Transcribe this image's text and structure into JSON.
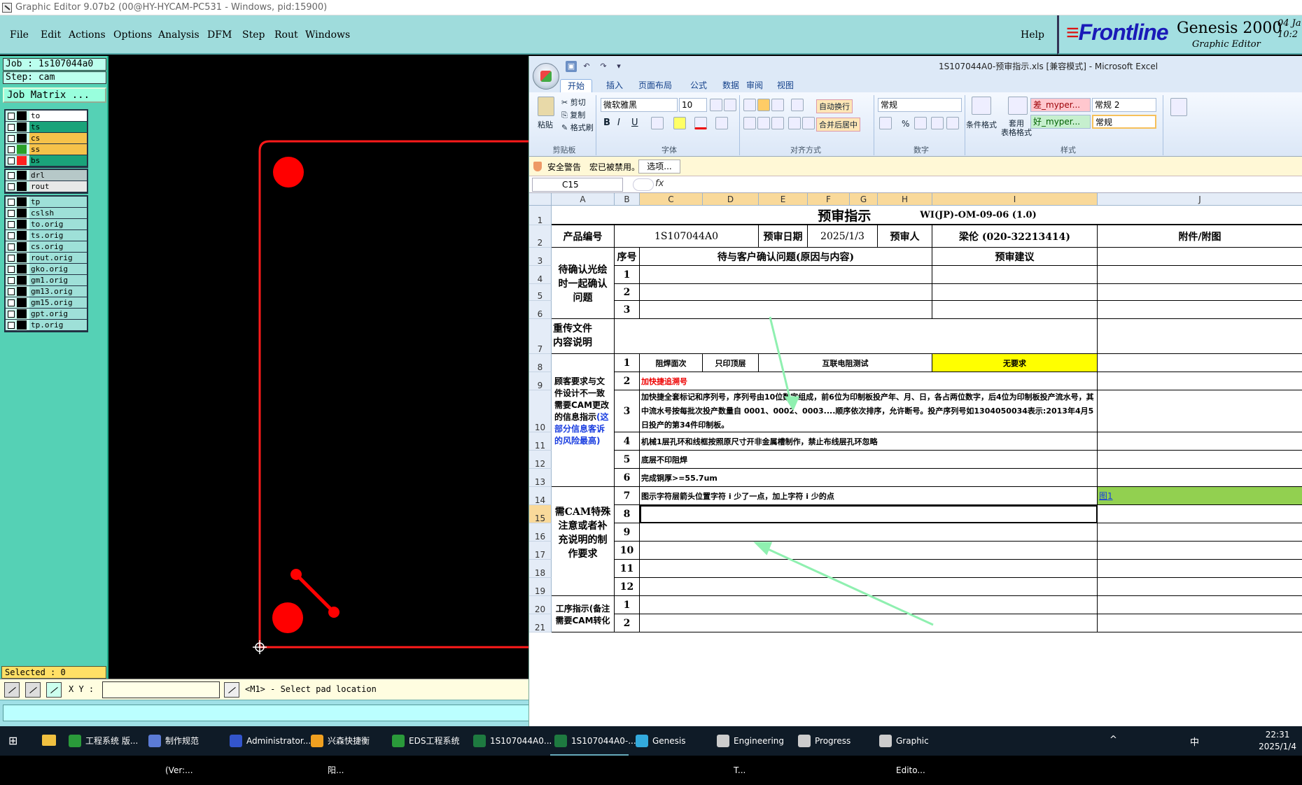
{
  "titlebar": {
    "title": "Graphic Editor 9.07b2 (00@HY-HYCAM-PC531 - Windows, pid:15900)"
  },
  "genesis_menu": {
    "items": [
      "File",
      "Edit",
      "Actions",
      "Options",
      "Analysis",
      "DFM",
      "Step",
      "Rout",
      "Windows"
    ],
    "help": "Help"
  },
  "brand": {
    "logo": "Frontline",
    "product": "Genesis 2000",
    "subtitle": "Graphic Editor",
    "date1": "04 Ja",
    "date2": "10:2"
  },
  "left_panel": {
    "job": "Job : 1s107044a0",
    "step": "Step: cam",
    "job_matrix": "Job Matrix ...",
    "group1": [
      {
        "name": "to",
        "color": "#ffffff",
        "sw": "#000000"
      },
      {
        "name": "ts",
        "color": "#1aa37a",
        "sw": "#000000"
      },
      {
        "name": "cs",
        "color": "#f5c24a",
        "sw": "#000000"
      },
      {
        "name": "ss",
        "color": "#f5c24a",
        "sw": "#2aa02a"
      },
      {
        "name": "bs",
        "color": "#1aa37a",
        "sw": "#ff2020"
      }
    ],
    "group2": [
      {
        "name": "drl",
        "color": "#b6c8c8",
        "sw": "#000000"
      },
      {
        "name": "rout",
        "color": "#e8e8e8",
        "sw": "#000000"
      }
    ],
    "group3": [
      "tp",
      "cslsh",
      "to.orig",
      "ts.orig",
      "cs.orig",
      "rout.orig",
      "gko.orig",
      "gm1.orig",
      "gm13.orig",
      "gm15.orig",
      "gpt.orig",
      "tp.orig"
    ],
    "selected": "Selected : 0"
  },
  "statusbar": {
    "xy_label": "X Y :",
    "xy_value": "",
    "prompt": "<M1> - Select pad location"
  },
  "excel": {
    "title": "1S107044A0-预审指示.xls  [兼容模式] - Microsoft Excel",
    "tabs": [
      "开始",
      "插入",
      "页面布局",
      "公式",
      "数据",
      "审阅",
      "视图"
    ],
    "clipboard": {
      "paste": "粘贴",
      "cut": "剪切",
      "copy": "复制",
      "format": "格式刷",
      "label": "剪贴板"
    },
    "font": {
      "name": "微软雅黑",
      "size": "10",
      "label": "字体",
      "bold": "B",
      "italic": "I",
      "underline": "U"
    },
    "align": {
      "wrap": "自动换行",
      "merge": "合并后居中",
      "label": "对齐方式"
    },
    "number": {
      "format": "常规",
      "label": "数字",
      "percent": "%"
    },
    "styles": {
      "cond": "条件格式",
      "table_fmt": "套用\n表格格式",
      "bad": "差_myper...",
      "good": "好_myper...",
      "normal2": "常规 2",
      "normal": "常规",
      "label": "样式"
    },
    "security": {
      "warning": "安全警告",
      "msg": "宏已被禁用。",
      "options": "选项..."
    },
    "namebox": "C15",
    "columns": [
      "A",
      "B",
      "C",
      "D",
      "E",
      "F",
      "G",
      "H",
      "I",
      "J"
    ],
    "rows": [
      "1",
      "2",
      "3",
      "4",
      "5",
      "6",
      "7",
      "8",
      "9",
      "10",
      "11",
      "12",
      "13",
      "14",
      "15",
      "16",
      "17",
      "18",
      "19",
      "20",
      "21"
    ],
    "sheet": {
      "title": "预审指示",
      "doc_no": "WI(JP)-OM-09-06 (1.0)",
      "r2": {
        "pn_label": "产品编号",
        "pn": "1S107044A0",
        "date_label": "预审日期",
        "date": "2025/1/3",
        "person_label": "预审人",
        "person": "梁伦 (020-32213414)",
        "attach": "附件/附图"
      },
      "r3": {
        "seq": "序号",
        "issue": "待与客户确认问题(原因与内容)",
        "suggest": "预审建议"
      },
      "sec_confirm": "待确认光绘时一起确认问题",
      "sec_reupload": "重传文件\n内容说明",
      "sec_customer_a": "顾客要求与文件设计不一致需要CAM更改的信息指示",
      "sec_customer_b": "(这部分信息客诉的风险最高)",
      "sec_cam": "需CAM特殊注意或者补充说明的制作要求",
      "sec_process": "工序指示(备注需要CAM转化",
      "r8": {
        "c": "阻焊面次",
        "d": "只印顶层",
        "e": "互联电阻测试",
        "i": "无要求"
      },
      "r9": "加快捷追溯号",
      "r10": "加快捷全套标记和序列号，序列号由10位数字组成，前6位为印制板投产年、月、日，各占两位数字，后4位为印制板投产流水号，其中流水号按每批次投产数量自 0001、0002、0003....顺序依次排序，允许断号。投产序列号如1304050034表示:2013年4月5日投产的第34件印制板。",
      "r11": "机械1层孔环和线框按照原尺寸开非金属槽制作，禁止布线层孔环忽略",
      "r12": "底层不印阻焊",
      "r13": "完成铜厚>=55.7um",
      "r14": "图示字符层箭头位置字符 i 少了一点，加上字符 i 少的点",
      "r14_link": "图1",
      "seq_nums": [
        "1",
        "2",
        "3",
        "1",
        "2",
        "3",
        "4",
        "5",
        "6",
        "7",
        "8",
        "9",
        "10",
        "11",
        "12",
        "1",
        "2"
      ]
    }
  },
  "taskbar": {
    "items": [
      {
        "label": "工程系统  版...",
        "color": "#2a9a3a"
      },
      {
        "label": "制作规范 (Ver:...",
        "color": "#5b7bd5"
      },
      {
        "label": "Administrator...",
        "color": "#3355cc"
      },
      {
        "label": "兴森快捷衡阳...",
        "color": "#f0a020"
      },
      {
        "label": "EDS工程系统",
        "color": "#2a9a3a"
      },
      {
        "label": "1S107044A0...",
        "color": "#1e7a40"
      },
      {
        "label": "1S107044A0-...",
        "color": "#1e7a40"
      },
      {
        "label": "Genesis",
        "color": "#33aadd"
      },
      {
        "label": "Engineering T...",
        "color": "#cccccc"
      },
      {
        "label": "Progress",
        "color": "#cccccc"
      },
      {
        "label": "Graphic Edito...",
        "color": "#cccccc"
      }
    ],
    "ime": "中",
    "time": "22:31",
    "date": "2025/1/4"
  },
  "colors": {
    "pad": "#ff0000",
    "profile": "#ff1a1a",
    "arrow": "#8ff0b0",
    "highlight": "#ffff00",
    "link_bg": "#92d050"
  }
}
